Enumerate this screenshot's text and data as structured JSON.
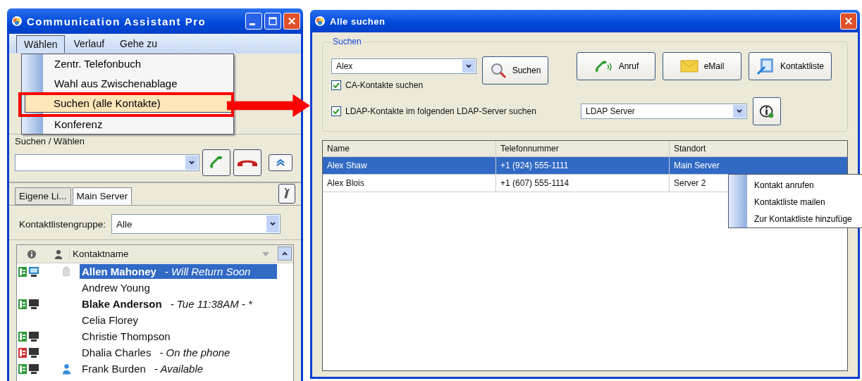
{
  "main_window": {
    "title": "Communication Assistant Pro",
    "menu_bar": [
      {
        "label": "Wählen",
        "selected": true
      },
      {
        "label": "Verlauf",
        "selected": false
      },
      {
        "label": "Gehe zu",
        "selected": false
      }
    ],
    "open_menu": [
      {
        "label": "Zentr. Telefonbuch",
        "selected": false
      },
      {
        "label": "Wahl aus Zwischenablage",
        "selected": false
      },
      {
        "label": "Suchen (alle Kontakte)",
        "selected": true
      },
      {
        "label": "Konferenz",
        "selected": false
      }
    ],
    "dial_label": "Suchen / Wählen",
    "tabs": [
      {
        "label": "Eigene Li...",
        "selected": false
      },
      {
        "label": "Main Server",
        "selected": true
      }
    ],
    "group_label": "Kontaktlistengruppe:",
    "group_value": "Alle",
    "list_header": "Kontaktname",
    "contacts": [
      {
        "name": "Allen Mahoney",
        "status": "- Will Return Soon",
        "bold": true,
        "selected": true,
        "status_icons": [
          {
            "kind": "phone",
            "color": "#2e9a3a"
          },
          {
            "kind": "ca-computer"
          }
        ],
        "presence": [
          {
            "kind": "cup"
          }
        ]
      },
      {
        "name": "Andrew Young",
        "bold": false,
        "selected": false
      },
      {
        "name": "Blake Anderson",
        "status": "- Tue 11:38AM -  *",
        "bold": true,
        "selected": false,
        "status_icons": [
          {
            "kind": "phone",
            "color": "#2e9a3a"
          },
          {
            "kind": "computer"
          }
        ]
      },
      {
        "name": "Celia Florey",
        "bold": false,
        "selected": false
      },
      {
        "name": "Christie Thompson",
        "bold": false,
        "selected": false,
        "status_icons": [
          {
            "kind": "phone",
            "color": "#2e9a3a"
          },
          {
            "kind": "computer"
          }
        ]
      },
      {
        "name": "Dhalia Charles",
        "status": "- On the phone",
        "bold": false,
        "selected": false,
        "status_icons": [
          {
            "kind": "phone",
            "color": "#d03030"
          },
          {
            "kind": "computer"
          }
        ]
      },
      {
        "name": "Frank Burden",
        "status": "- Available",
        "bold": false,
        "selected": false,
        "status_icons": [
          {
            "kind": "phone",
            "color": "#2e9a3a"
          },
          {
            "kind": "computer"
          }
        ],
        "presence": [
          {
            "kind": "person"
          }
        ]
      }
    ]
  },
  "search_window": {
    "title": "Alle suchen",
    "group_title": "Suchen",
    "search_value": "Alex",
    "buttons": [
      {
        "label": "Suchen",
        "kind": "search"
      },
      {
        "label": "Anruf",
        "kind": "call"
      },
      {
        "label": "eMail",
        "kind": "mail"
      },
      {
        "label": "Kontaktliste",
        "kind": "contacts"
      }
    ],
    "options": [
      {
        "label": "CA-Kontakte suchen",
        "checked": true
      },
      {
        "label": "LDAP-Kontakte im folgenden LDAP-Server suchen",
        "checked": true
      }
    ],
    "ldap_server": "LDAP Server",
    "table": {
      "columns": [
        "Name",
        "Telefonnummer",
        "Standort"
      ],
      "rows": [
        {
          "cells": [
            "Alex Shaw",
            "+1 (924) 555-1111",
            "Main Server"
          ],
          "selected": true
        },
        {
          "cells": [
            "Alex Blois",
            "+1 (607) 555-1114",
            "Server 2"
          ],
          "selected": false
        }
      ]
    },
    "context_menu": [
      "Kontakt anrufen",
      "Kontaktliste mailen",
      "Zur Kontaktliste hinzufüge"
    ]
  }
}
